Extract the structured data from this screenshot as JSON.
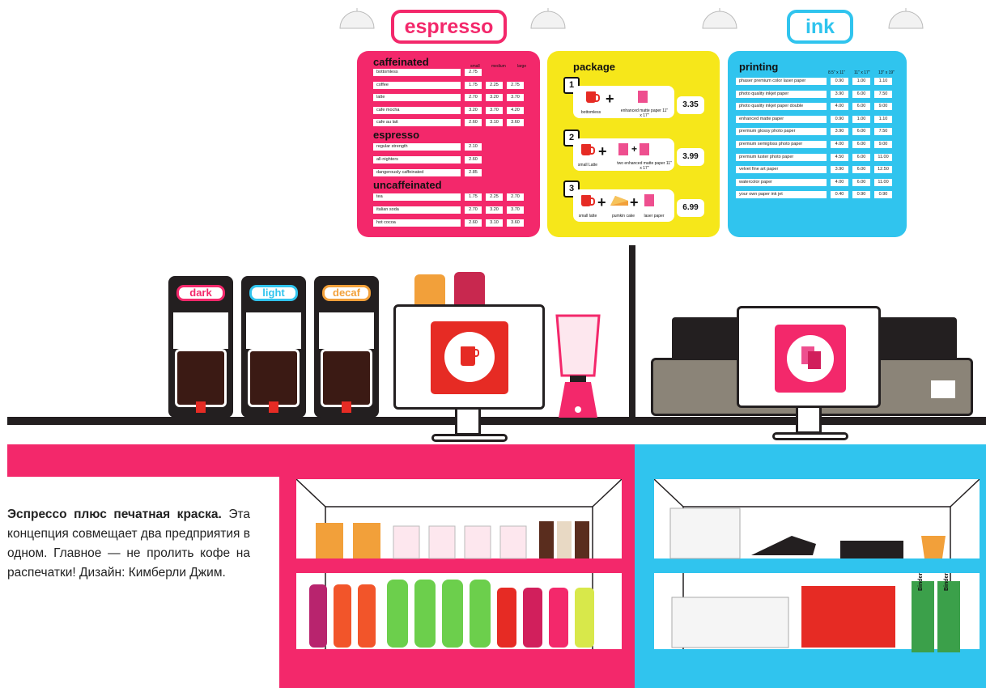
{
  "signs": {
    "espresso": "espresso",
    "ink": "ink"
  },
  "colors": {
    "pink": "#f3286b",
    "yellow": "#f6e71a",
    "cyan": "#30c4ee",
    "dark": "#231f20",
    "red": "#e62b24"
  },
  "coffee_menu": {
    "size_headers": [
      "small",
      "medium",
      "large"
    ],
    "caffeinated": {
      "title": "caffeinated",
      "items": [
        {
          "name": "bottomless",
          "prices": [
            "2.75"
          ]
        },
        {
          "name": "coffee",
          "prices": [
            "1.75",
            "2.25",
            "2.75"
          ]
        },
        {
          "name": "latte",
          "prices": [
            "2.70",
            "3.20",
            "3.70"
          ]
        },
        {
          "name": "cafe mocha",
          "prices": [
            "3.20",
            "3.70",
            "4.20"
          ]
        },
        {
          "name": "cafe au lait",
          "prices": [
            "2.60",
            "3.10",
            "3.60"
          ]
        }
      ]
    },
    "espresso": {
      "title": "espresso",
      "items": [
        {
          "name": "regular strength",
          "prices": [
            "2.10"
          ]
        },
        {
          "name": "all-nighters",
          "prices": [
            "2.60"
          ]
        },
        {
          "name": "dangerously caffeinated",
          "prices": [
            "2.85"
          ]
        }
      ]
    },
    "uncaffeinated": {
      "title": "uncaffeinated",
      "items": [
        {
          "name": "tea",
          "prices": [
            "1.75",
            "2.25",
            "2.70"
          ]
        },
        {
          "name": "italian soda",
          "prices": [
            "2.70",
            "3.20",
            "3.70"
          ]
        },
        {
          "name": "hot cocoa",
          "prices": [
            "2.60",
            "3.10",
            "3.60"
          ]
        }
      ]
    }
  },
  "package_menu": {
    "title": "package",
    "items": [
      {
        "number": "1",
        "price": "3.35",
        "cap1": "bottomless",
        "cap2": "enhanced matte paper 11\" x 17\""
      },
      {
        "number": "2",
        "price": "3.99",
        "cap1": "small Latte",
        "cap2": "two enhanced matte paper 11\" x 17\""
      },
      {
        "number": "3",
        "price": "6.99",
        "cap1": "small latte",
        "cap2": "pumkin cake",
        "cap3": "laser paper"
      }
    ]
  },
  "printing_menu": {
    "title": "printing",
    "size_headers": [
      "8.5\" x 11\"",
      "11\" x 17\"",
      "13\" x 19\""
    ],
    "items": [
      {
        "name": "phaser premium color laser paper",
        "prices": [
          "0.90",
          "1.00",
          "1.10"
        ]
      },
      {
        "name": "photo quality inkjet paper",
        "prices": [
          "3.90",
          "6.00",
          "7.50"
        ]
      },
      {
        "name": "photo quality inkjet paper double",
        "prices": [
          "4.00",
          "6.00",
          "9.00"
        ]
      },
      {
        "name": "enhanced matte paper",
        "prices": [
          "0.90",
          "1.00",
          "1.10"
        ]
      },
      {
        "name": "premium glossy photo paper",
        "prices": [
          "3.90",
          "6.00",
          "7.50"
        ]
      },
      {
        "name": "premium semigloss photo paper",
        "prices": [
          "4.00",
          "6.00",
          "9.00"
        ]
      },
      {
        "name": "premium luster photo paper",
        "prices": [
          "4.50",
          "6.00",
          "11.00"
        ]
      },
      {
        "name": "velvet fine art paper",
        "prices": [
          "3.90",
          "6.00",
          "12.50"
        ]
      },
      {
        "name": "watercolor paper",
        "prices": [
          "4.00",
          "6.00",
          "11.00"
        ]
      },
      {
        "name": "your own paper ink jet",
        "prices": [
          "0.40",
          "0.90",
          "0.90"
        ]
      }
    ]
  },
  "dispensers": [
    {
      "label": "dark",
      "color": "#f3286b"
    },
    {
      "label": "light",
      "color": "#30c4ee"
    },
    {
      "label": "decaf",
      "color": "#f2a03a"
    }
  ],
  "caption": {
    "bold": "Эспрессо плюс печатная краска.",
    "text": "Эта концепция совмещает два предприятия в одном. Главное — не пролить кофе на распечатки! Дизайн: Кимберли Джим."
  },
  "binders": [
    "Binder",
    "Binder"
  ]
}
